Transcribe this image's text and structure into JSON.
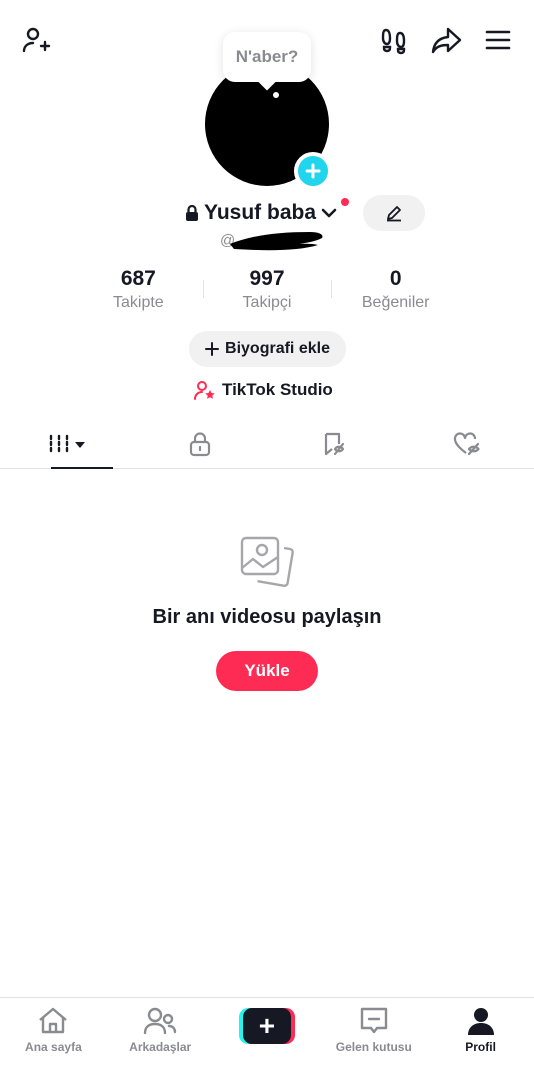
{
  "header": {
    "add_friend_icon": "person-plus-icon",
    "footprints_icon": "footprints-icon",
    "share_icon": "share-arrow-icon",
    "menu_icon": "hamburger-menu-icon"
  },
  "profile": {
    "note_bubble": "N'aber?",
    "name": "Yusuf baba",
    "handle": "@",
    "stats": [
      {
        "value": "687",
        "label": "Takipte"
      },
      {
        "value": "997",
        "label": "Takipçi"
      },
      {
        "value": "0",
        "label": "Beğeniler"
      }
    ],
    "bio_button": "Biyografi ekle",
    "studio_link": "TikTok Studio"
  },
  "tabs": [
    {
      "icon": "videos-grid-icon"
    },
    {
      "icon": "lock-icon"
    },
    {
      "icon": "bookmark-icon"
    },
    {
      "icon": "liked-heart-icon"
    }
  ],
  "empty_state": {
    "title": "Bir anı videosu paylaşın",
    "upload_button": "Yükle"
  },
  "bottom_nav": [
    {
      "label": "Ana sayfa",
      "icon": "home-icon"
    },
    {
      "label": "Arkadaşlar",
      "icon": "friends-icon"
    },
    {
      "label": "",
      "icon": "create-plus-icon"
    },
    {
      "label": "Gelen kutusu",
      "icon": "inbox-icon"
    },
    {
      "label": "Profil",
      "icon": "profile-icon"
    }
  ],
  "colors": {
    "accent": "#fe2c55",
    "cyan": "#20d5ec",
    "text": "#161823",
    "muted": "#8a8b91"
  }
}
